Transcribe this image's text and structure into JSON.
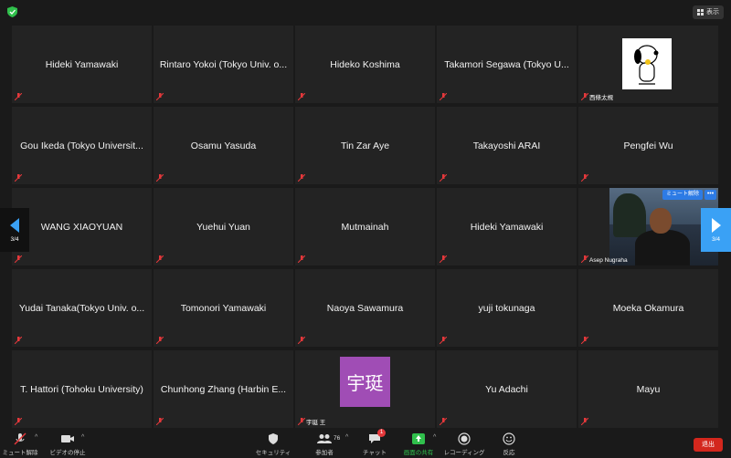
{
  "topbar": {
    "view_label": "表示"
  },
  "tiles": [
    {
      "name": "Hideki Yamawaki"
    },
    {
      "name": "Rintaro Yokoi (Tokyo Univ. o..."
    },
    {
      "name": "Hideko Koshima"
    },
    {
      "name": "Takamori Segawa (Tokyo U..."
    },
    {
      "caption": "西條太規"
    },
    {
      "name": "Gou Ikeda (Tokyo Universit..."
    },
    {
      "name": "Osamu Yasuda"
    },
    {
      "name": "Tin Zar Aye"
    },
    {
      "name": "Takayoshi ARAI"
    },
    {
      "name": "Pengfei Wu"
    },
    {
      "name": "WANG XIAOYUAN"
    },
    {
      "name": "Yuehui Yuan"
    },
    {
      "name": "Mutmainah"
    },
    {
      "name": "Hideki Yamawaki"
    },
    {
      "caption": "Asep Nugraha",
      "unmute_label": "ミュート解除",
      "more_label": "•••"
    },
    {
      "name": "Yudai Tanaka(Tokyo Univ. o..."
    },
    {
      "name": "Tomonori Yamawaki"
    },
    {
      "name": "Naoya Sawamura"
    },
    {
      "name": "yuji tokunaga"
    },
    {
      "name": "Moeka Okamura"
    },
    {
      "name": "T. Hattori (Tohoku University)"
    },
    {
      "name": "Chunhong Zhang (Harbin E..."
    },
    {
      "caption": "宇珽 王",
      "avatar_text": "宇珽"
    },
    {
      "name": "Yu Adachi"
    },
    {
      "name": "Mayu"
    }
  ],
  "pager": {
    "left": "3/4",
    "right": "3/4"
  },
  "toolbar": {
    "mute_label": "ミュート解除",
    "video_label": "ビデオの停止",
    "security_label": "セキュリティ",
    "participants_label": "参加者",
    "participants_count": "76",
    "chat_label": "チャット",
    "chat_badge": "1",
    "share_label": "画面の共有",
    "record_label": "レコーディング",
    "reactions_label": "反応",
    "leave_label": "退出"
  },
  "colors": {
    "accent": "#3aa1f5",
    "share": "#30c04c",
    "leave": "#d3271d",
    "avatar": "#a04db5"
  }
}
